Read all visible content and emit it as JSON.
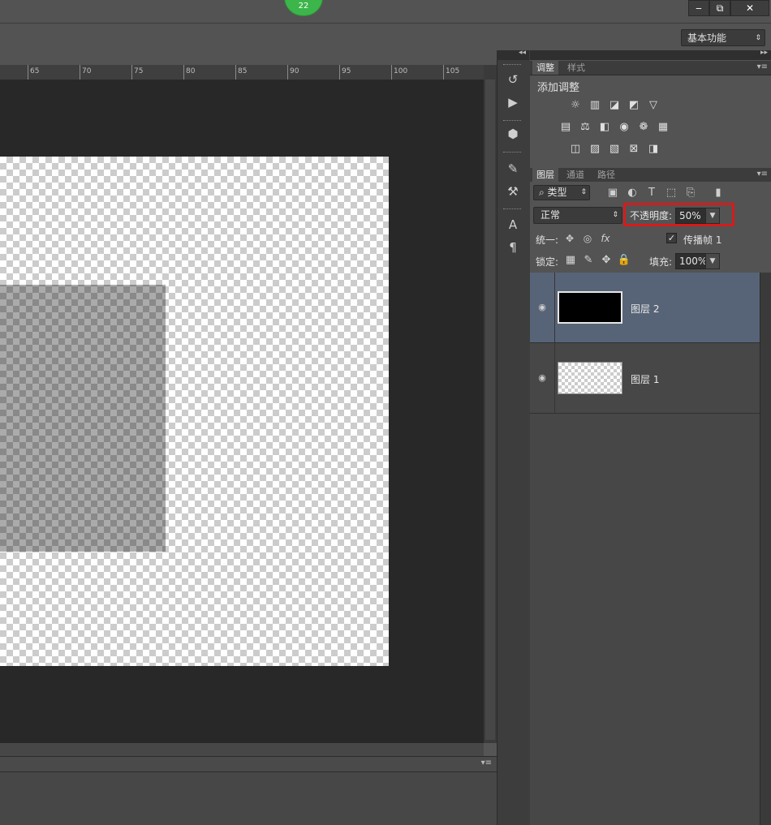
{
  "app": {
    "badge": "22",
    "window_buttons": [
      "‒",
      "⧉",
      "✕"
    ],
    "workspace": "基本功能"
  },
  "ruler": {
    "labels": [
      "65",
      "70",
      "75",
      "80",
      "85",
      "90",
      "95",
      "100",
      "105"
    ]
  },
  "adjustments_panel": {
    "tabs": [
      "调整",
      "样式"
    ],
    "title": "添加调整"
  },
  "layers_panel": {
    "tabs": [
      "图层",
      "通道",
      "路径"
    ],
    "filter_label": "⌕ 类型",
    "blend_mode": "正常",
    "opacity_label": "不透明度:",
    "opacity_value": "50%",
    "unify_label": "统一:",
    "propagate_label": "传播帧 1",
    "propagate_checked": true,
    "lock_label": "锁定:",
    "fill_label": "填充:",
    "fill_value": "100%",
    "layers": [
      {
        "name": "图层 2",
        "selected": true,
        "visible": true
      },
      {
        "name": "图层 1",
        "selected": false,
        "visible": true
      }
    ]
  },
  "colors": {
    "selected_layer": "#576477",
    "highlight_box": "#d41c1c",
    "badge": "#3cb54a"
  }
}
